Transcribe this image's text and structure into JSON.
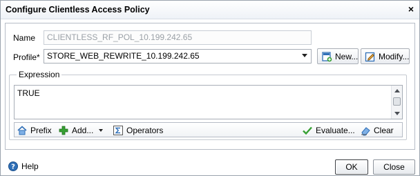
{
  "window": {
    "title": "Configure Clientless Access Policy",
    "close_glyph": "×"
  },
  "form": {
    "name_label": "Name",
    "name_value": "CLIENTLESS_RF_POL_10.199.242.65",
    "profile_label": "Profile*",
    "profile_value": "STORE_WEB_REWRITE_10.199.242.65",
    "new_label": "New...",
    "modify_label": "Modify..."
  },
  "expression": {
    "legend": "Expression",
    "text": "TRUE",
    "toolbar": {
      "prefix": "Prefix",
      "add": "Add...",
      "operators": "Operators",
      "evaluate": "Evaluate...",
      "clear": "Clear"
    }
  },
  "footer": {
    "help": "Help",
    "ok": "OK",
    "close": "Close"
  },
  "colors": {
    "accent_blue": "#2f6fb7",
    "green": "#37a033",
    "title_gradient_end": "#eef2f7"
  },
  "icons": {
    "new": "new-document-icon",
    "modify": "pencil-edit-icon",
    "prefix": "house-prefix-icon",
    "add": "green-plus-icon",
    "operators": "sigma-icon",
    "evaluate": "green-check-icon",
    "clear": "eraser-icon",
    "help": "help-icon"
  }
}
